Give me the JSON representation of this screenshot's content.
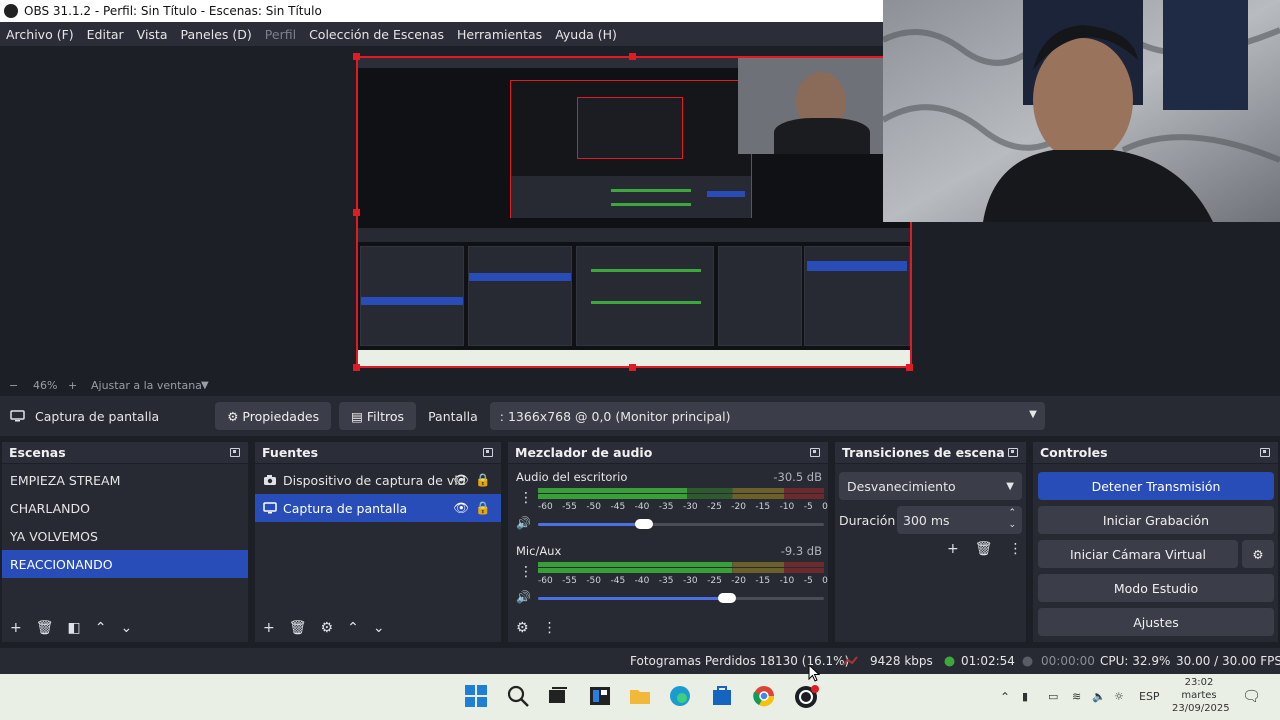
{
  "window": {
    "title": "OBS 31.1.2 - Perfil: Sin Título - Escenas: Sin Título"
  },
  "menu": {
    "items": [
      "Archivo (F)",
      "Editar",
      "Vista",
      "Paneles (D)",
      "Perfil",
      "Colección de Escenas",
      "Herramientas",
      "Ayuda (H)"
    ]
  },
  "zoom": {
    "level": "46%",
    "fit_label": "Ajustar a la ventana"
  },
  "source_toolbar": {
    "source_name": "Captura de pantalla",
    "properties_label": "Propiedades",
    "filters_label": "Filtros",
    "display_label": "Pantalla",
    "display_value": ": 1366x768 @ 0,0 (Monitor principal)"
  },
  "scenes": {
    "title": "Escenas",
    "items": [
      {
        "label": "EMPIEZA STREAM",
        "selected": false
      },
      {
        "label": "CHARLANDO",
        "selected": false
      },
      {
        "label": "YA VOLVEMOS",
        "selected": false
      },
      {
        "label": "REACCIONANDO",
        "selected": true
      }
    ]
  },
  "sources": {
    "title": "Fuentes",
    "items": [
      {
        "label": "Dispositivo de captura de vid",
        "icon": "camera-icon",
        "selected": false
      },
      {
        "label": "Captura de pantalla",
        "icon": "monitor-icon",
        "selected": true
      }
    ]
  },
  "mixer": {
    "title": "Mezclador de audio",
    "ticks": [
      "-60",
      "-55",
      "-50",
      "-45",
      "-40",
      "-35",
      "-30",
      "-25",
      "-20",
      "-15",
      "-10",
      "-5",
      "0"
    ],
    "channels": [
      {
        "name": "Audio del escritorio",
        "db": "-30.5 dB",
        "level": 0.52,
        "volume": 0.37
      },
      {
        "name": "Mic/Aux",
        "db": "-9.3 dB",
        "level": 0.68,
        "volume": 0.66
      }
    ]
  },
  "transitions": {
    "title": "Transiciones de escena",
    "selected": "Desvanecimiento",
    "duration_label": "Duración",
    "duration_value": "300 ms"
  },
  "controls": {
    "title": "Controles",
    "stop_stream": "Detener Transmisión",
    "start_recording": "Iniciar Grabación",
    "start_virtual_cam": "Iniciar Cámara Virtual",
    "studio_mode": "Modo Estudio",
    "settings": "Ajustes"
  },
  "status": {
    "dropped_frames": "Fotogramas Perdidos 18130 (16.1%)",
    "bitrate": "9428 kbps",
    "stream_time": "01:02:54",
    "rec_time": "00:00:00",
    "cpu": "CPU: 32.9%",
    "fps": "30.00 / 30.00 FPS"
  },
  "taskbar": {
    "lang": "ESP",
    "time": "23:02",
    "day": "martes",
    "date": "23/09/2025"
  },
  "colors": {
    "accent": "#284cb8",
    "live_red": "#e01b24",
    "meter_green": "#3aa83a",
    "meter_yellow": "#b9a33a",
    "meter_red": "#a8333a"
  }
}
